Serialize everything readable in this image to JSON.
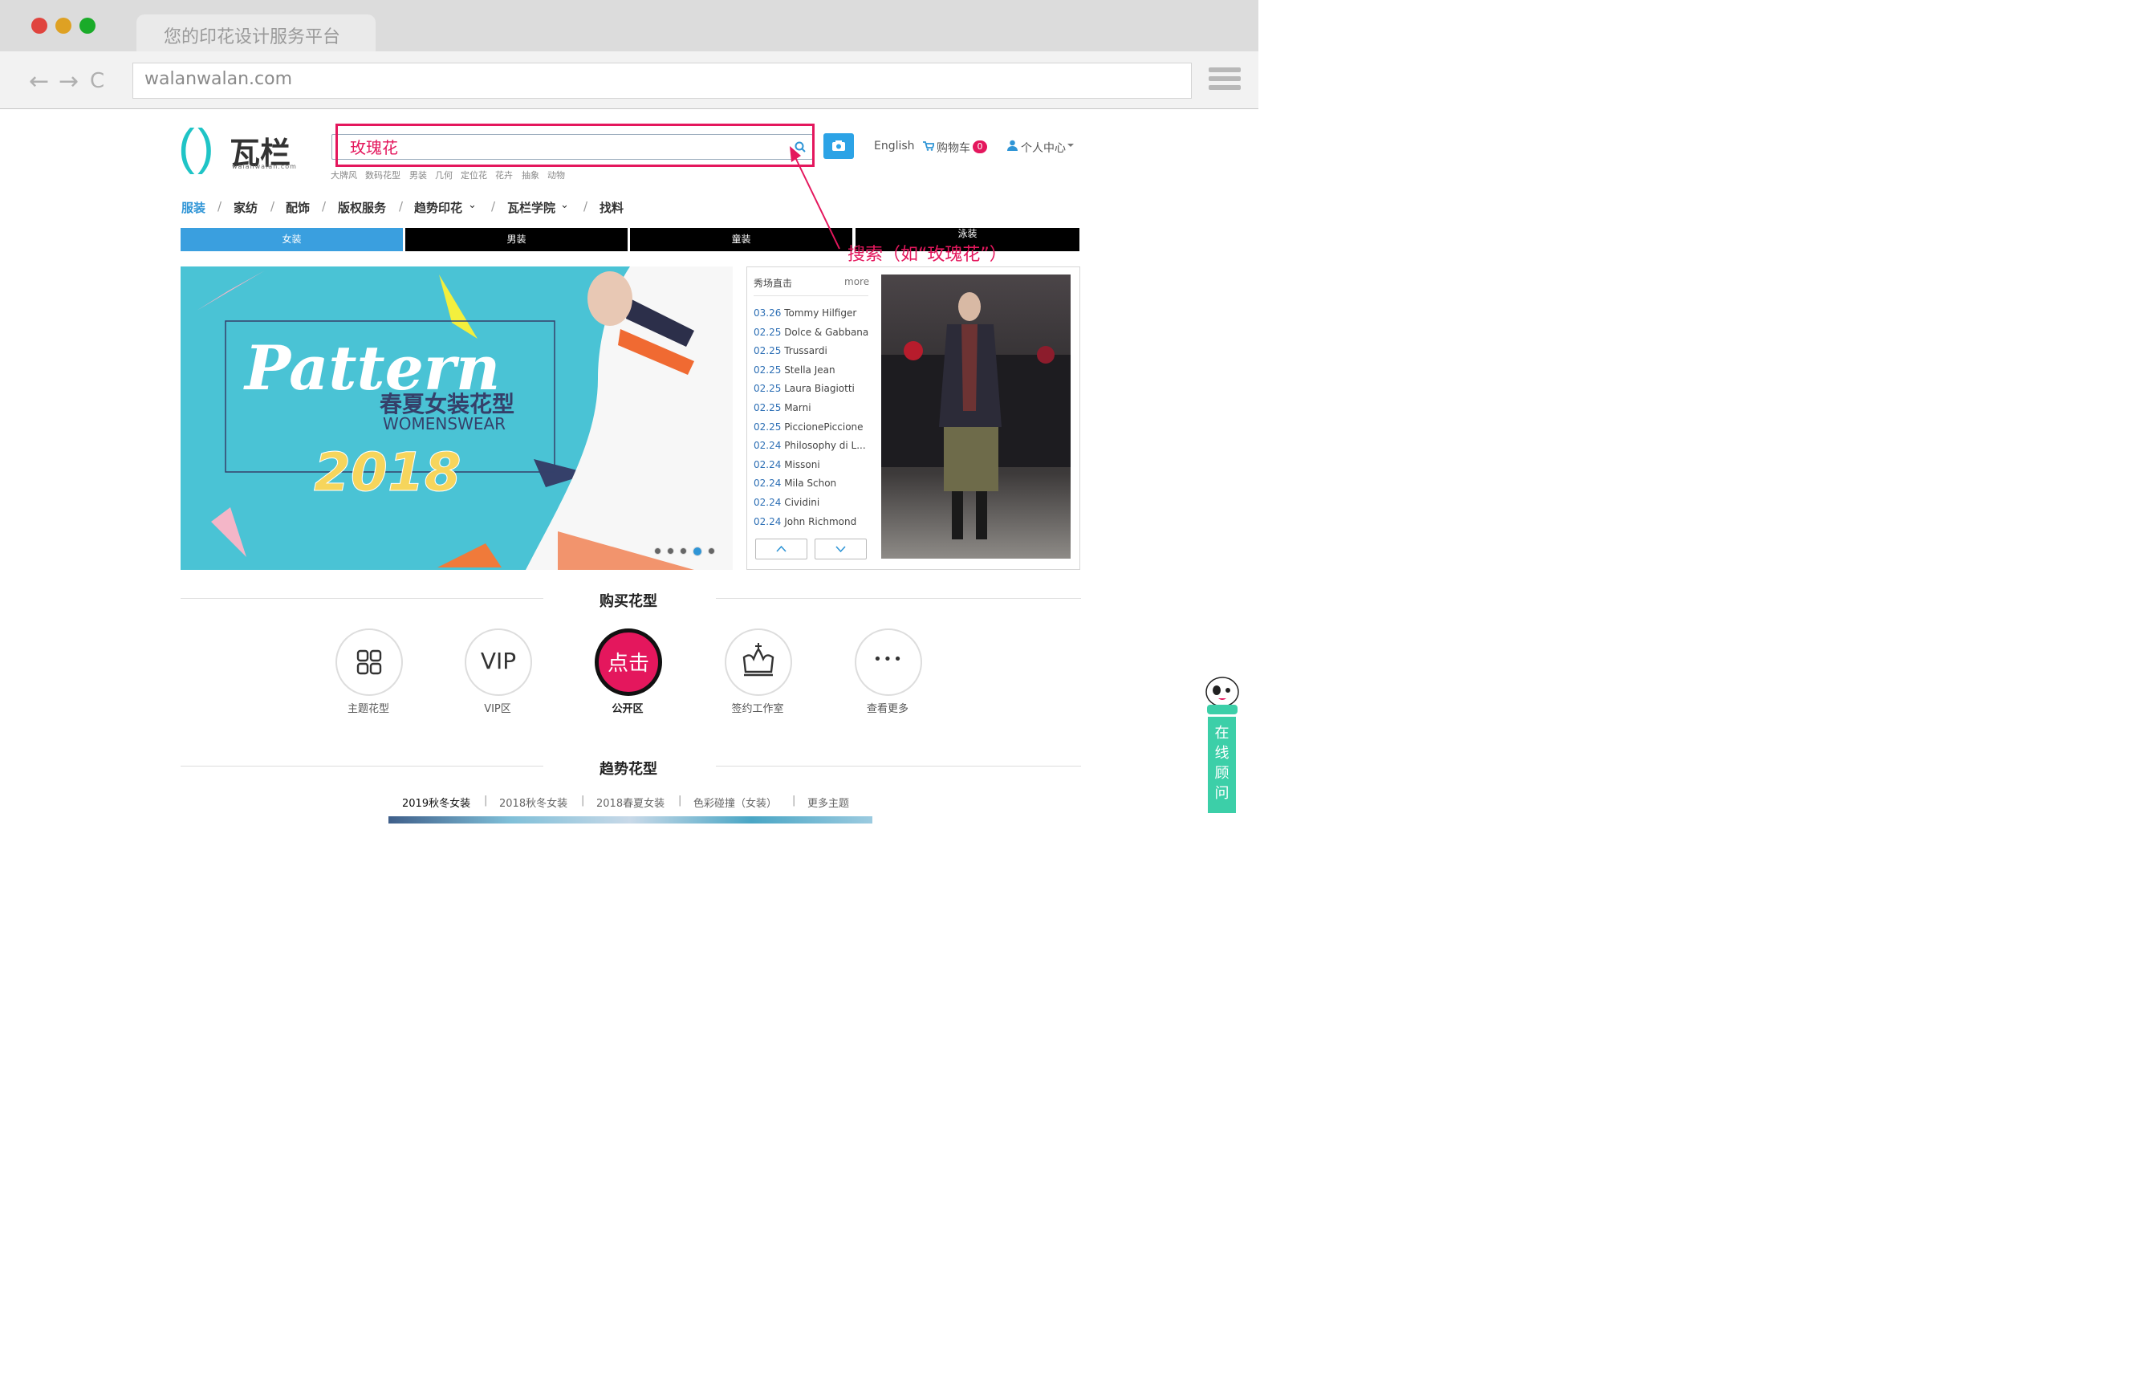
{
  "browser": {
    "tab_title": "您的印花设计服务平台",
    "url": "walanwalan.com",
    "back": "←",
    "forward": "→",
    "reload": "C"
  },
  "header": {
    "logo_text": "瓦栏",
    "logo_sub": "walanwalan.com",
    "search_value": "玫瑰花",
    "hot_keywords": [
      "大牌风",
      "数码花型",
      "男装",
      "几何",
      "定位花",
      "花卉",
      "抽象",
      "动物"
    ],
    "language": "English",
    "cart_label": "购物车",
    "cart_count": "0",
    "account_label": "个人中心"
  },
  "annotation": "搜索（如“玫瑰花”）",
  "categories": [
    "服装",
    "家纺",
    "配饰",
    "版权服务",
    "趋势印花",
    "瓦栏学院",
    "找料"
  ],
  "category_sep": "/",
  "subtabs": [
    "女装",
    "男装",
    "童装",
    "泳装"
  ],
  "banner": {
    "headline": "Pattern",
    "sub_cn": "春夏女装花型",
    "sub_en": "WOMENSWEAR",
    "year": "2018",
    "slide_count": 5,
    "active_slide": 4
  },
  "runway": {
    "title": "秀场直击",
    "more": "more",
    "items": [
      {
        "date": "03.26",
        "name": "Tommy Hilfiger"
      },
      {
        "date": "02.25",
        "name": "Dolce & Gabbana"
      },
      {
        "date": "02.25",
        "name": "Trussardi"
      },
      {
        "date": "02.25",
        "name": "Stella Jean"
      },
      {
        "date": "02.25",
        "name": "Laura Biagiotti"
      },
      {
        "date": "02.25",
        "name": "Marni"
      },
      {
        "date": "02.25",
        "name": "PiccionePiccione"
      },
      {
        "date": "02.24",
        "name": "Philosophy di L..."
      },
      {
        "date": "02.24",
        "name": "Missoni"
      },
      {
        "date": "02.24",
        "name": "Mila Schon"
      },
      {
        "date": "02.24",
        "name": "Cividini"
      },
      {
        "date": "02.24",
        "name": "John Richmond"
      }
    ]
  },
  "buy": {
    "title": "购买花型",
    "items": [
      {
        "label": "主题花型",
        "icon": "grid-icon"
      },
      {
        "label": "VIP区",
        "icon": "vip-icon",
        "glyph": "VIP"
      },
      {
        "label": "公开区",
        "icon": "click-icon",
        "glyph": "点击"
      },
      {
        "label": "签约工作室",
        "icon": "crown-icon"
      },
      {
        "label": "查看更多",
        "icon": "more-icon",
        "glyph": "•••"
      }
    ]
  },
  "trend": {
    "title": "趋势花型",
    "tabs": [
      "2019秋冬女装",
      "2018秋冬女装",
      "2018春夏女装",
      "色彩碰撞（女装）",
      "更多主题"
    ],
    "sep": "|"
  },
  "consult": "在线顾问",
  "colors": {
    "accent": "#e4175d",
    "blue": "#2f95d6",
    "teal": "#1fc4c6"
  }
}
